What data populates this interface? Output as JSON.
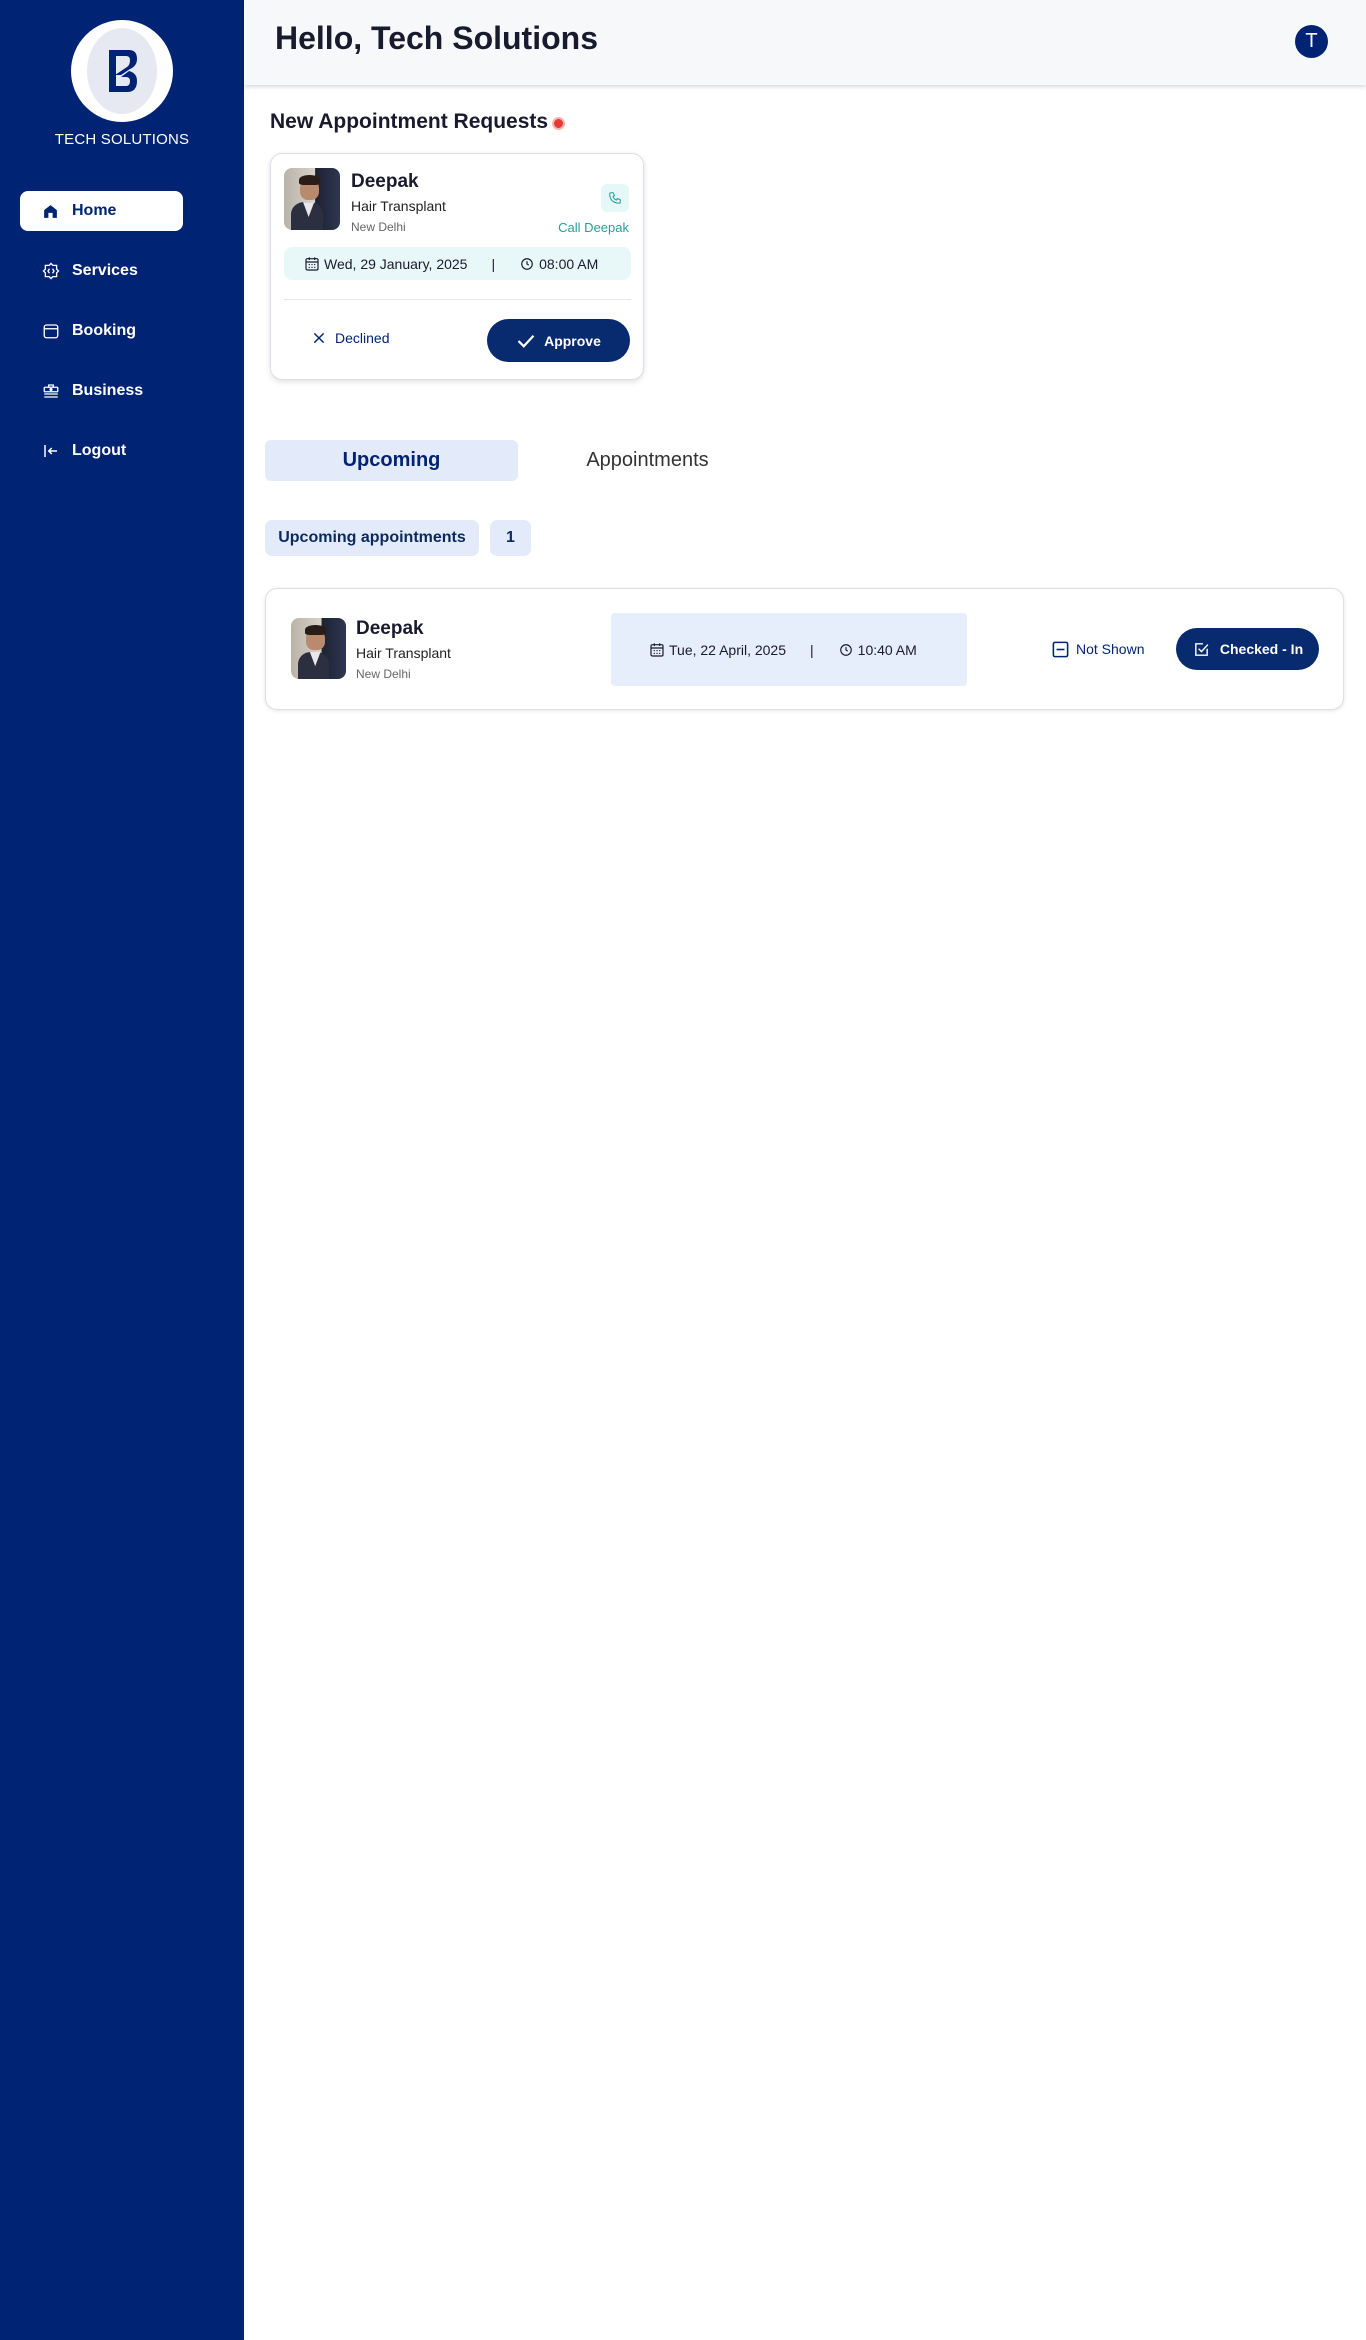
{
  "brand": {
    "name": "TECH SOLUTIONS"
  },
  "sidebar": {
    "items": [
      {
        "label": "Home",
        "icon": "home-icon",
        "active": true
      },
      {
        "label": "Services",
        "icon": "services-icon"
      },
      {
        "label": "Booking",
        "icon": "booking-icon"
      },
      {
        "label": "Business",
        "icon": "business-icon"
      },
      {
        "label": "Logout",
        "icon": "logout-icon"
      }
    ]
  },
  "header": {
    "title": "Hello, Tech Solutions",
    "avatar_initial": "T"
  },
  "requests": {
    "heading": "New Appointment Requests",
    "card": {
      "name": "Deepak",
      "service": "Hair Transplant",
      "city": "New Delhi",
      "call_label": "Call Deepak",
      "date": "Wed, 29 January, 2025",
      "separator": "|",
      "time": "08:00 AM",
      "decline_label": "Declined",
      "approve_label": "Approve"
    }
  },
  "tabs": {
    "items": [
      {
        "label": "Upcoming"
      },
      {
        "label": "Appointments"
      }
    ]
  },
  "upcoming": {
    "label": "Upcoming appointments",
    "count": "1",
    "card": {
      "name": "Deepak",
      "service": "Hair Transplant",
      "city": "New Delhi",
      "date": "Tue, 22 April, 2025",
      "separator": "|",
      "time": "10:40 AM",
      "not_shown_label": "Not Shown",
      "checkin_label": "Checked - In"
    }
  },
  "colors": {
    "sidebar": "#002473",
    "primary_button": "#082a6e",
    "accent_teal": "#2a9d9c",
    "tab_active_bg": "#e3ebfb",
    "notification_dot": "#e53935"
  }
}
